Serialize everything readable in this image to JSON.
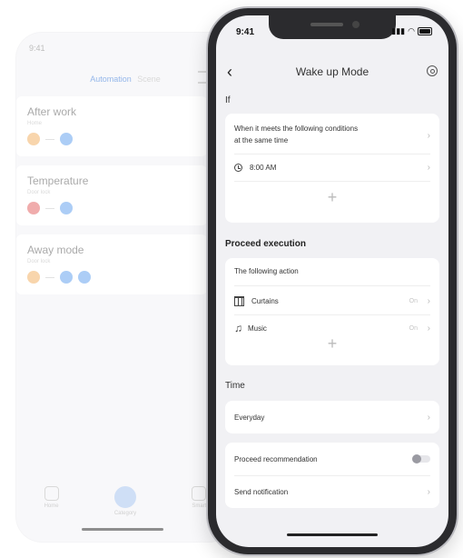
{
  "background_app": {
    "status_time": "9:41",
    "tabs": {
      "active": "Automation",
      "inactive": "Scene"
    },
    "cards": [
      {
        "title": "After work",
        "subtitle": "Home"
      },
      {
        "title": "Temperature",
        "subtitle": "Door lock"
      },
      {
        "title": "Away mode",
        "subtitle": "Door lock"
      }
    ],
    "nav": {
      "home": "Home",
      "category": "Category",
      "smart": "Smart"
    }
  },
  "status_bar": {
    "time": "9:41"
  },
  "header": {
    "title": "Wake up Mode"
  },
  "if_section": {
    "label": "If",
    "conditions_line1": "When it meets the following conditions",
    "conditions_line2": "at the same time",
    "time_value": "8:00 AM"
  },
  "execution": {
    "label": "Proceed execution",
    "header": "The following action",
    "items": [
      {
        "name": "Curtains",
        "state": "On"
      },
      {
        "name": "Music",
        "state": "On"
      }
    ]
  },
  "time_section": {
    "label": "Time",
    "repeat": "Everyday"
  },
  "options": {
    "recommendation": "Proceed recommendation",
    "recommendation_enabled": false,
    "notification": "Send notification"
  }
}
